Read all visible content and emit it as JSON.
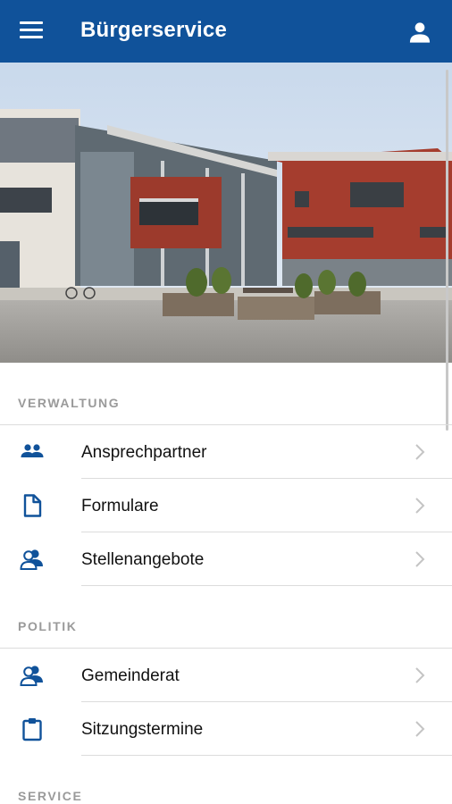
{
  "header": {
    "title": "Bürgerservice",
    "menu_icon": "menu-icon",
    "profile_icon": "person-icon",
    "background_color": "#10529a"
  },
  "hero": {
    "image_description_icon": "town-hall-photo"
  },
  "sections": [
    {
      "header": "VERWALTUNG",
      "items": [
        {
          "label": "Ansprechpartner",
          "icon": "people-icon"
        },
        {
          "label": "Formulare",
          "icon": "document-icon"
        },
        {
          "label": "Stellenangebote",
          "icon": "group-icon"
        }
      ]
    },
    {
      "header": "POLITIK",
      "items": [
        {
          "label": "Gemeinderat",
          "icon": "group-icon"
        },
        {
          "label": "Sitzungstermine",
          "icon": "clipboard-icon"
        }
      ]
    },
    {
      "header": "SERVICE",
      "items": []
    }
  ],
  "colors": {
    "accent": "#10529a",
    "section_header": "#9a9a9a",
    "divider": "#dcdcdc",
    "chevron": "#c4c4c4"
  }
}
